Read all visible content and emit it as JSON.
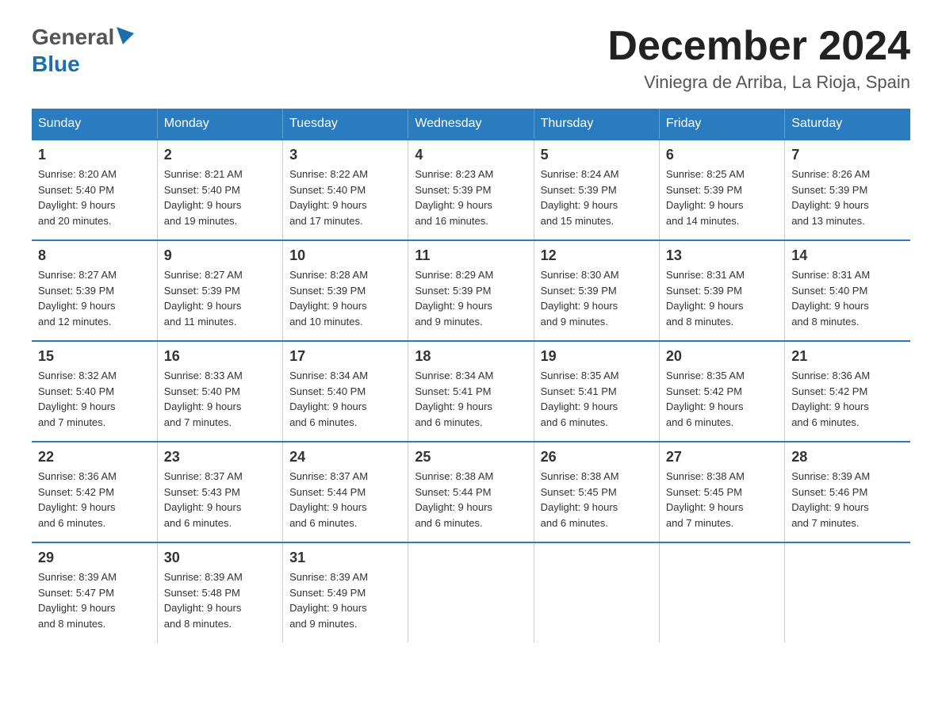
{
  "header": {
    "logo_general": "General",
    "logo_blue": "Blue",
    "main_title": "December 2024",
    "subtitle": "Viniegra de Arriba, La Rioja, Spain"
  },
  "days_of_week": [
    "Sunday",
    "Monday",
    "Tuesday",
    "Wednesday",
    "Thursday",
    "Friday",
    "Saturday"
  ],
  "weeks": [
    [
      {
        "day": "1",
        "sunrise": "8:20 AM",
        "sunset": "5:40 PM",
        "daylight": "9 hours and 20 minutes."
      },
      {
        "day": "2",
        "sunrise": "8:21 AM",
        "sunset": "5:40 PM",
        "daylight": "9 hours and 19 minutes."
      },
      {
        "day": "3",
        "sunrise": "8:22 AM",
        "sunset": "5:40 PM",
        "daylight": "9 hours and 17 minutes."
      },
      {
        "day": "4",
        "sunrise": "8:23 AM",
        "sunset": "5:39 PM",
        "daylight": "9 hours and 16 minutes."
      },
      {
        "day": "5",
        "sunrise": "8:24 AM",
        "sunset": "5:39 PM",
        "daylight": "9 hours and 15 minutes."
      },
      {
        "day": "6",
        "sunrise": "8:25 AM",
        "sunset": "5:39 PM",
        "daylight": "9 hours and 14 minutes."
      },
      {
        "day": "7",
        "sunrise": "8:26 AM",
        "sunset": "5:39 PM",
        "daylight": "9 hours and 13 minutes."
      }
    ],
    [
      {
        "day": "8",
        "sunrise": "8:27 AM",
        "sunset": "5:39 PM",
        "daylight": "9 hours and 12 minutes."
      },
      {
        "day": "9",
        "sunrise": "8:27 AM",
        "sunset": "5:39 PM",
        "daylight": "9 hours and 11 minutes."
      },
      {
        "day": "10",
        "sunrise": "8:28 AM",
        "sunset": "5:39 PM",
        "daylight": "9 hours and 10 minutes."
      },
      {
        "day": "11",
        "sunrise": "8:29 AM",
        "sunset": "5:39 PM",
        "daylight": "9 hours and 9 minutes."
      },
      {
        "day": "12",
        "sunrise": "8:30 AM",
        "sunset": "5:39 PM",
        "daylight": "9 hours and 9 minutes."
      },
      {
        "day": "13",
        "sunrise": "8:31 AM",
        "sunset": "5:39 PM",
        "daylight": "9 hours and 8 minutes."
      },
      {
        "day": "14",
        "sunrise": "8:31 AM",
        "sunset": "5:40 PM",
        "daylight": "9 hours and 8 minutes."
      }
    ],
    [
      {
        "day": "15",
        "sunrise": "8:32 AM",
        "sunset": "5:40 PM",
        "daylight": "9 hours and 7 minutes."
      },
      {
        "day": "16",
        "sunrise": "8:33 AM",
        "sunset": "5:40 PM",
        "daylight": "9 hours and 7 minutes."
      },
      {
        "day": "17",
        "sunrise": "8:34 AM",
        "sunset": "5:40 PM",
        "daylight": "9 hours and 6 minutes."
      },
      {
        "day": "18",
        "sunrise": "8:34 AM",
        "sunset": "5:41 PM",
        "daylight": "9 hours and 6 minutes."
      },
      {
        "day": "19",
        "sunrise": "8:35 AM",
        "sunset": "5:41 PM",
        "daylight": "9 hours and 6 minutes."
      },
      {
        "day": "20",
        "sunrise": "8:35 AM",
        "sunset": "5:42 PM",
        "daylight": "9 hours and 6 minutes."
      },
      {
        "day": "21",
        "sunrise": "8:36 AM",
        "sunset": "5:42 PM",
        "daylight": "9 hours and 6 minutes."
      }
    ],
    [
      {
        "day": "22",
        "sunrise": "8:36 AM",
        "sunset": "5:42 PM",
        "daylight": "9 hours and 6 minutes."
      },
      {
        "day": "23",
        "sunrise": "8:37 AM",
        "sunset": "5:43 PM",
        "daylight": "9 hours and 6 minutes."
      },
      {
        "day": "24",
        "sunrise": "8:37 AM",
        "sunset": "5:44 PM",
        "daylight": "9 hours and 6 minutes."
      },
      {
        "day": "25",
        "sunrise": "8:38 AM",
        "sunset": "5:44 PM",
        "daylight": "9 hours and 6 minutes."
      },
      {
        "day": "26",
        "sunrise": "8:38 AM",
        "sunset": "5:45 PM",
        "daylight": "9 hours and 6 minutes."
      },
      {
        "day": "27",
        "sunrise": "8:38 AM",
        "sunset": "5:45 PM",
        "daylight": "9 hours and 7 minutes."
      },
      {
        "day": "28",
        "sunrise": "8:39 AM",
        "sunset": "5:46 PM",
        "daylight": "9 hours and 7 minutes."
      }
    ],
    [
      {
        "day": "29",
        "sunrise": "8:39 AM",
        "sunset": "5:47 PM",
        "daylight": "9 hours and 8 minutes."
      },
      {
        "day": "30",
        "sunrise": "8:39 AM",
        "sunset": "5:48 PM",
        "daylight": "9 hours and 8 minutes."
      },
      {
        "day": "31",
        "sunrise": "8:39 AM",
        "sunset": "5:49 PM",
        "daylight": "9 hours and 9 minutes."
      },
      null,
      null,
      null,
      null
    ]
  ],
  "labels": {
    "sunrise": "Sunrise:",
    "sunset": "Sunset:",
    "daylight": "Daylight:"
  }
}
